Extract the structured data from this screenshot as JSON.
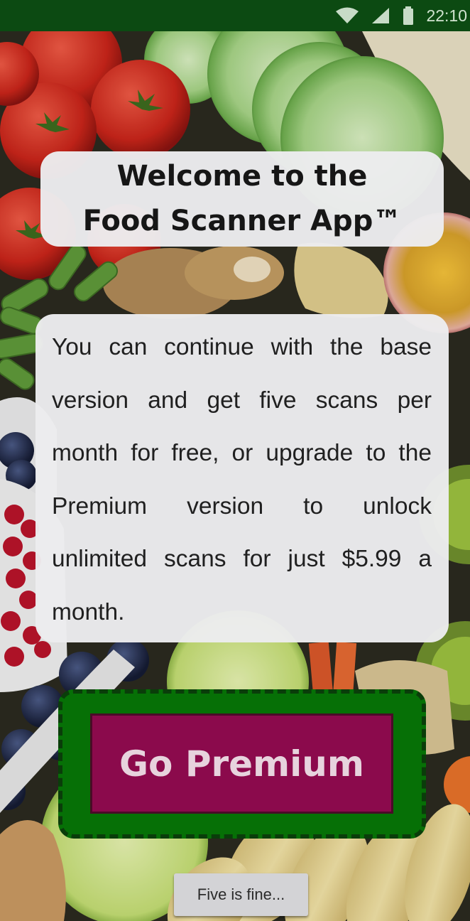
{
  "status_bar": {
    "time": "22:10",
    "icons": [
      "wifi-icon",
      "signal-icon",
      "battery-icon"
    ],
    "background_color": "#0c4a12"
  },
  "background": {
    "description_icon": "fresh-produce-photo"
  },
  "title_card": {
    "line1": "Welcome to the",
    "line2": "Food Scanner App™"
  },
  "description_card": {
    "text": "You can continue with the base version and get five scans per month for free, or upgrade to the Premium version  to unlock unlimited scans for just $5.99 a month."
  },
  "premium_button": {
    "label": "Go Premium",
    "button_color": "#8b0a4c",
    "frame_color": "#067006"
  },
  "skip_button": {
    "label": "Five is fine..."
  }
}
